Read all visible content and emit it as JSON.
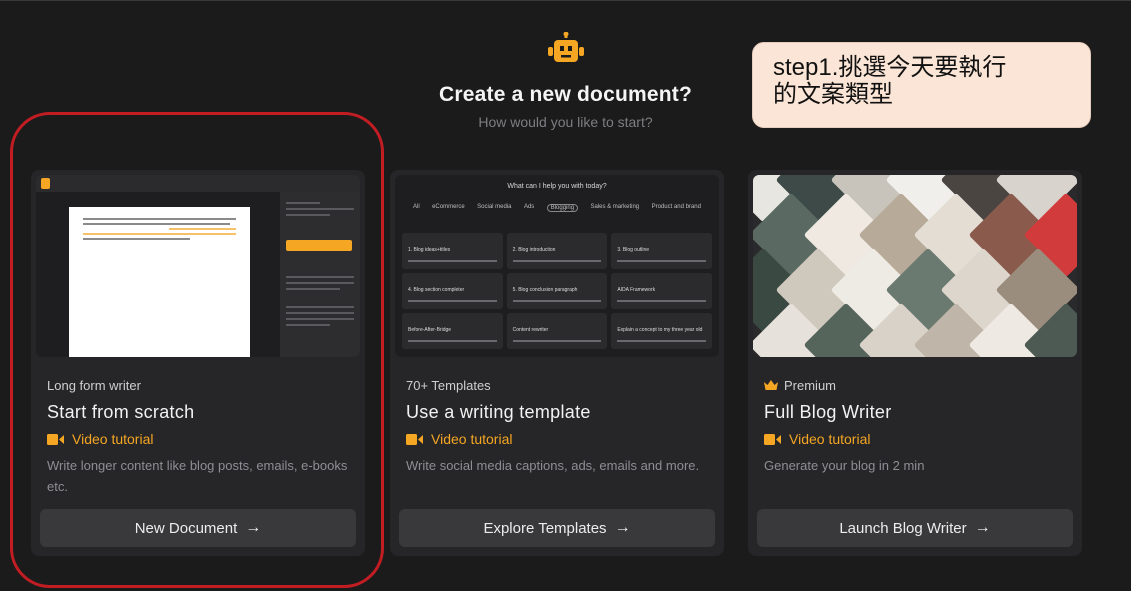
{
  "header": {
    "title": "Create a new document?",
    "subtitle": "How would you like to start?"
  },
  "callout": {
    "text_line1": "step1.挑選今天要執行",
    "text_line2": "的文案類型"
  },
  "cards": [
    {
      "category": "Long form writer",
      "title": "Start from scratch",
      "video_label": "Video tutorial",
      "description": "Write longer content like blog posts, emails, e-books etc.",
      "button_label": "New Document"
    },
    {
      "category": "70+ Templates",
      "title": "Use a writing template",
      "video_label": "Video tutorial",
      "description": "Write social media captions, ads, emails and more.",
      "button_label": "Explore Templates"
    },
    {
      "category": "Premium",
      "title": "Full Blog Writer",
      "video_label": "Video tutorial",
      "description": "Generate your blog in 2 min",
      "button_label": "Launch Blog Writer"
    }
  ],
  "template_preview": {
    "heading": "What can I help you with today?",
    "tabs": [
      "All",
      "eCommerce",
      "Social media",
      "Ads",
      "Blogging",
      "Sales & marketing",
      "Product and brand"
    ],
    "items": [
      "1. Blog ideas+titles",
      "2. Blog introduction",
      "3. Blog outline",
      "4. Blog section completer",
      "5. Blog conclusion paragraph",
      "AIDA Framework",
      "Before-After-Bridge",
      "Content rewriter",
      "Explain a concept to my three year old"
    ]
  },
  "colors": {
    "background": "#1b1b1c",
    "card": "#262628",
    "accent": "#f5a623",
    "highlight_ring": "#c21d22",
    "callout_bg": "#fbe5d6"
  },
  "icons": {
    "header": "robot-icon",
    "video": "video-camera-icon",
    "premium": "crown-icon",
    "button": "arrow-right-icon"
  }
}
